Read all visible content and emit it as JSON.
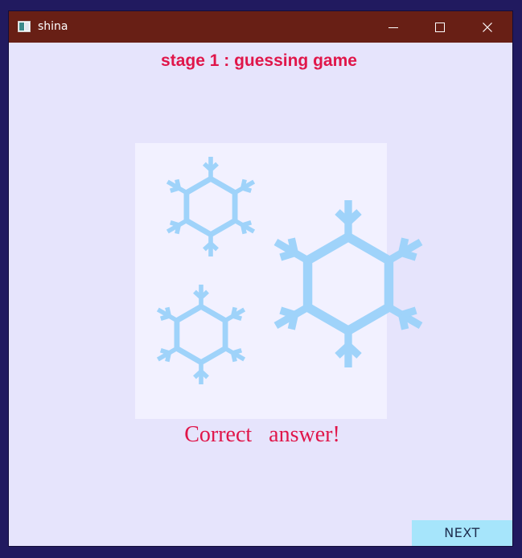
{
  "window": {
    "title": "shina",
    "app_icon": "window-app-icon",
    "controls": {
      "minimize_icon": "minimize-icon",
      "maximize_icon": "maximize-icon",
      "close_icon": "close-icon"
    },
    "titlebar_color": "#681f15"
  },
  "game": {
    "stage_title": "stage 1 : guessing game",
    "result_text": "Correct   answer!",
    "next_label": "NEXT",
    "picture": {
      "description_icon": "snowflake-icon",
      "snowflake_count": 3
    }
  },
  "colors": {
    "accent_text": "#e0164a",
    "background": "#e6e4fc",
    "card": "#f2f1ff",
    "snowflake": "#9fd3fa",
    "next_button": "#a6e5fb"
  }
}
